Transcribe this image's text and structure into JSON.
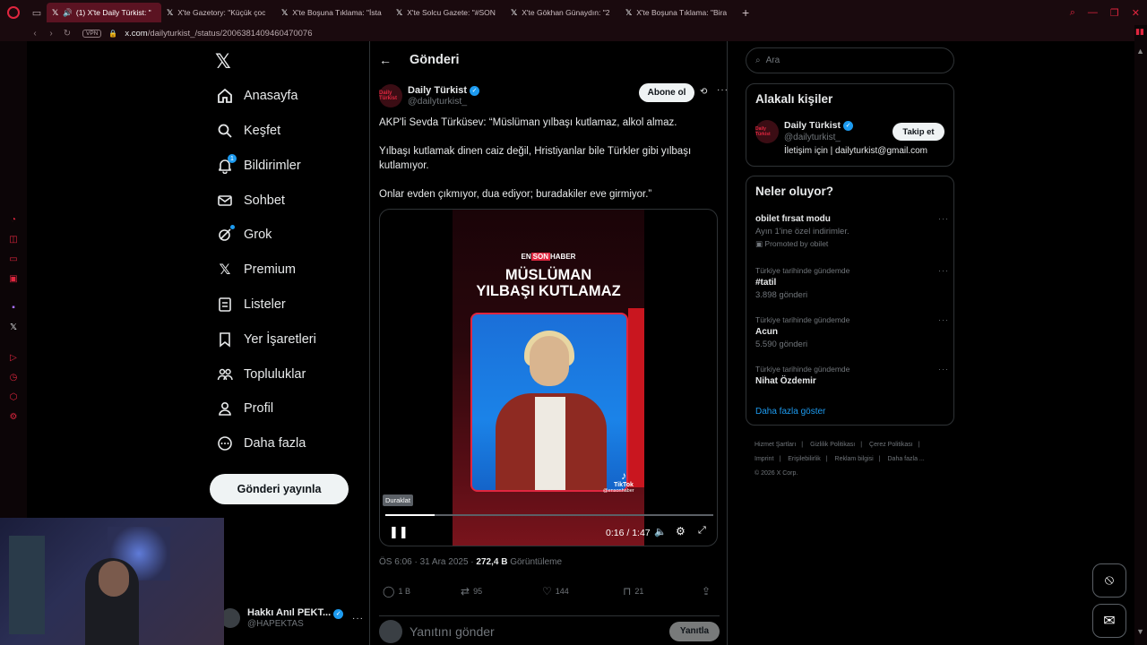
{
  "browser": {
    "tabs": [
      {
        "label": "(1) X'te Daily Türkist: \"",
        "active": true
      },
      {
        "label": "X'te Gazetory: \"Küçük çoc",
        "active": false
      },
      {
        "label": "X'te Boşuna Tıklama: \"İsta",
        "active": false
      },
      {
        "label": "X'te Solcu Gazete: \"#SON",
        "active": false
      },
      {
        "label": "X'te Gökhan Günaydın: \"2",
        "active": false
      },
      {
        "label": "X'te Boşuna Tıklama: \"Bira",
        "active": false
      }
    ],
    "vpn_label": "VPN",
    "url_host": "x.com",
    "url_path": "/dailyturkist_/status/2006381409460470076",
    "accent": "#e0263f"
  },
  "nav": {
    "items": [
      {
        "label": "Anasayfa",
        "icon": "home-icon"
      },
      {
        "label": "Keşfet",
        "icon": "search-icon"
      },
      {
        "label": "Bildirimler",
        "icon": "bell-icon",
        "badge": "1"
      },
      {
        "label": "Sohbet",
        "icon": "mail-icon"
      },
      {
        "label": "Grok",
        "icon": "grok-icon"
      },
      {
        "label": "Premium",
        "icon": "x-icon"
      },
      {
        "label": "Listeler",
        "icon": "list-icon"
      },
      {
        "label": "Yer İşaretleri",
        "icon": "bookmark-icon"
      },
      {
        "label": "Topluluklar",
        "icon": "communities-icon"
      },
      {
        "label": "Profil",
        "icon": "person-icon"
      },
      {
        "label": "Daha fazla",
        "icon": "more-circle-icon"
      }
    ],
    "post_button": "Gönderi yayınla"
  },
  "account": {
    "name": "Hakkı Anıl PEKT...",
    "handle": "@HAPEKTAS"
  },
  "main": {
    "title": "Gönderi",
    "author": {
      "name": "Daily Türkist",
      "handle": "@dailyturkist_",
      "avatar_text": "Daily Türkist",
      "subscribe": "Abone ol"
    },
    "text": [
      "AKP'li Sevda Türküsev: “Müslüman yılbaşı kutlamaz, alkol almaz.",
      "Yılbaşı kutlamak dinen caiz değil, Hristiyanlar bile Türkler gibi yılbaşı kutlamıyor.",
      "Onlar evden çıkmıyor, dua ediyor; buradakiler eve girmiyor.”"
    ],
    "video": {
      "tag_prefix": "EN",
      "tag_highlight": "SON",
      "tag_suffix": "HABER",
      "headline_1": "MÜSLÜMAN",
      "headline_2": "YILBAŞI KUTLAMAZ",
      "tiktok": "TikTok",
      "tiktok_handle": "@ensonhaber",
      "tooltip": "Duraklat",
      "time": "0:16 / 1:47",
      "progress": 0.15
    },
    "meta": {
      "time": "ÖS 6:06 · 31 Ara 2025 · ",
      "views": "272,4 B",
      "views_label": " Görüntüleme"
    },
    "actions": {
      "replies": "1 B",
      "reposts": "95",
      "likes": "144",
      "bookmarks": "21"
    },
    "reply": {
      "placeholder": "Yanıtını gönder",
      "button": "Yanıtla"
    }
  },
  "right": {
    "search_placeholder": "Ara",
    "related_title": "Alakalı kişiler",
    "related": {
      "name": "Daily Türkist",
      "handle": "@dailyturkist_",
      "bio": "İletişim için | dailyturkist@gmail.com",
      "follow": "Takip et",
      "avatar_text": "Daily Türkist"
    },
    "trends_title": "Neler oluyor?",
    "trends": [
      {
        "ctx": "",
        "name": "obilet fırsat modu",
        "sub": "Ayın 1'ine özel indirimler.",
        "promo": "Promoted by obilet"
      },
      {
        "ctx": "Türkiye tarihinde gündemde",
        "name": "#tatil",
        "sub": "3.898 gönderi"
      },
      {
        "ctx": "Türkiye tarihinde gündemde",
        "name": "Acun",
        "sub": "5.590 gönderi"
      },
      {
        "ctx": "Türkiye tarihinde gündemde",
        "name": "Nihat Özdemir",
        "sub": ""
      }
    ],
    "show_more": "Daha fazla göster",
    "footer": {
      "l1": "Hizmet Şartları",
      "l2": "Gizlilik Politikası",
      "l3": "Çerez Politikası",
      "l4": "Imprint",
      "l5": "Erişilebilirlik",
      "l6": "Reklam bilgisi",
      "l7": "Daha fazla ...",
      "copyright": "© 2026 X Corp."
    }
  }
}
